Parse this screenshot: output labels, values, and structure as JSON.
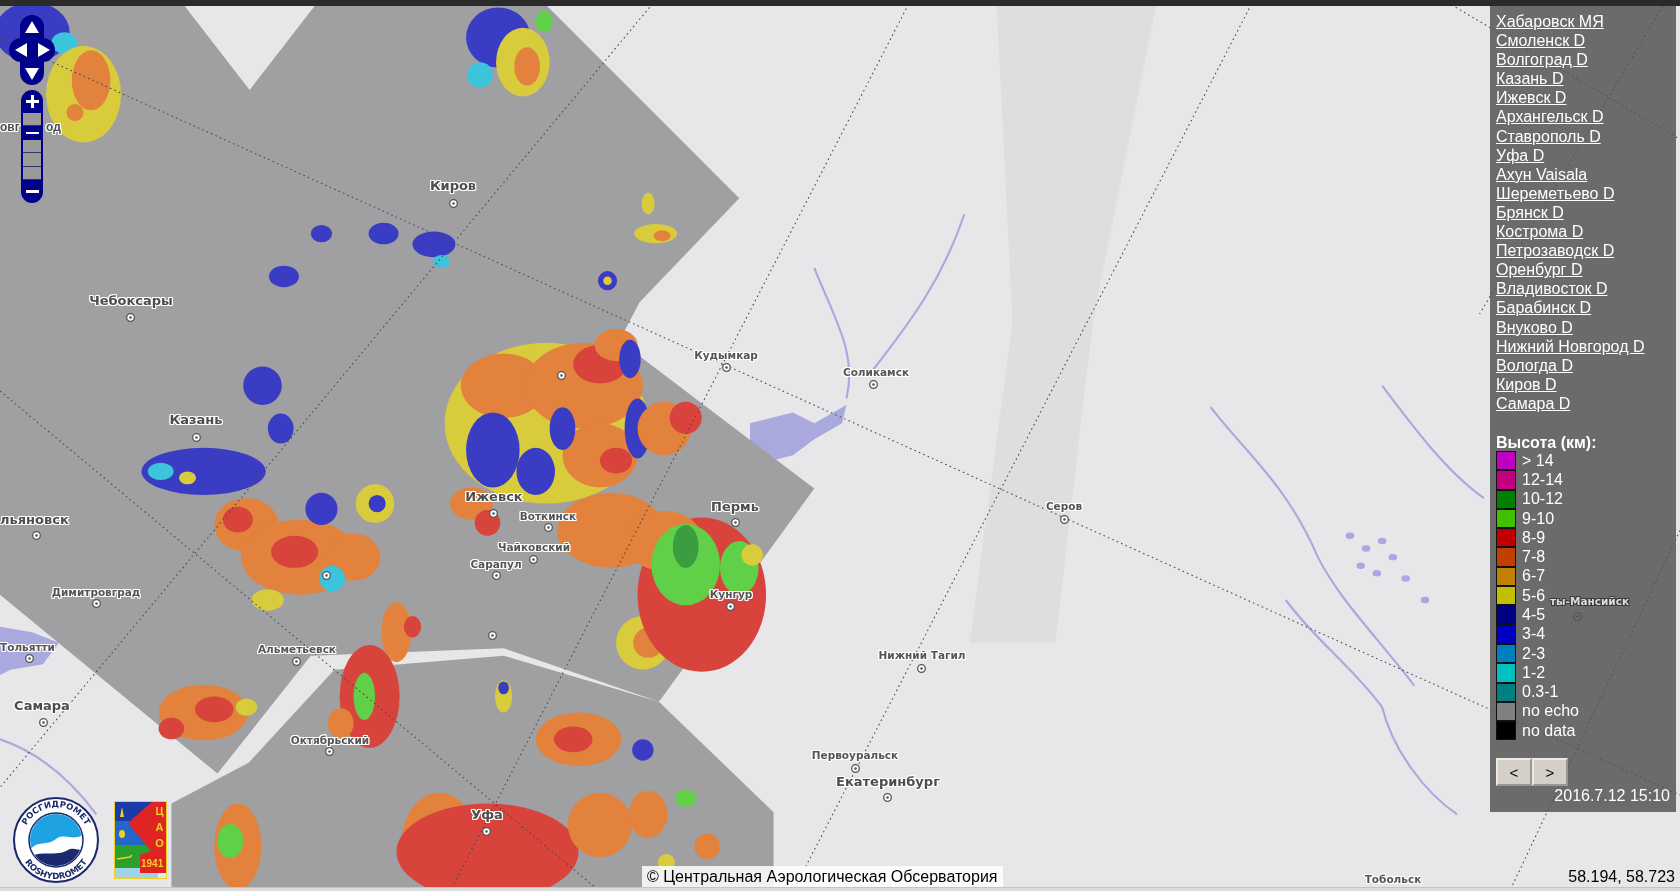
{
  "map_controls": {
    "zoom": {
      "steps": [
        {
          "selected": false
        },
        {
          "selected": true
        },
        {
          "selected": false
        },
        {
          "selected": false
        },
        {
          "selected": false
        }
      ]
    }
  },
  "map": {
    "cities": [
      {
        "name_parts": [
          "овг",
          "од"
        ],
        "kind": "major"
      },
      {
        "name": "Киров",
        "kind": "major"
      },
      {
        "name": "Чебоксары",
        "kind": "major"
      },
      {
        "name": "Кудымкар",
        "kind": "minor"
      },
      {
        "name": "Соликамск",
        "kind": "minor"
      },
      {
        "name": "Казань",
        "kind": "major"
      },
      {
        "name": "Ижевск",
        "kind": "major"
      },
      {
        "name": "Воткинск",
        "kind": "minor"
      },
      {
        "name": "Пермь",
        "kind": "major"
      },
      {
        "name": "Серов",
        "kind": "minor"
      },
      {
        "name": "льяновск",
        "kind": "major"
      },
      {
        "name": "Чайковский",
        "kind": "minor"
      },
      {
        "name": "Сарапул",
        "kind": "minor"
      },
      {
        "name": "Димитровград",
        "kind": "minor"
      },
      {
        "name": "Кунгур",
        "kind": "minor"
      },
      {
        "name": "ты-Мансийск",
        "kind": "minor"
      },
      {
        "name": "Тольятти",
        "kind": "minor"
      },
      {
        "name": "Альметьевск",
        "kind": "minor"
      },
      {
        "name": "Нижний Тагил",
        "kind": "minor"
      },
      {
        "name": "Самара",
        "kind": "major"
      },
      {
        "name": "Октябрьский",
        "kind": "minor"
      },
      {
        "name": "Первоуральск",
        "kind": "minor"
      },
      {
        "name": "Екатеринбург",
        "kind": "major"
      },
      {
        "name": "Уфа",
        "kind": "major"
      },
      {
        "name": "Тобольск",
        "kind": "minor"
      }
    ]
  },
  "stations_panel": {
    "links": [
      "Хабаровск МЯ",
      "Смоленск D",
      "Волгоград D",
      "Казань D",
      "Ижевск D",
      "Архангельск D",
      "Ставрополь D",
      "Уфа D",
      "Ахун Vaisala",
      "Шереметьево D",
      "Брянск D",
      "Кострома D",
      "Петрозаводск D",
      "Оренбург D",
      "Владивосток D",
      "Барабинск D",
      "Внуково D",
      "Нижний Новгород D",
      "Вологда D",
      "Киров D",
      "Самара D"
    ]
  },
  "legend": {
    "title": "Высота (км):",
    "items": [
      {
        "label": "> 14",
        "color": "#c000c0"
      },
      {
        "label": "12-14",
        "color": "#c00080"
      },
      {
        "label": "10-12",
        "color": "#008000"
      },
      {
        "label": "9-10",
        "color": "#40c000"
      },
      {
        "label": "8-9",
        "color": "#c00000"
      },
      {
        "label": "7-8",
        "color": "#c04000"
      },
      {
        "label": "6-7",
        "color": "#c08000"
      },
      {
        "label": "5-6",
        "color": "#c0c000"
      },
      {
        "label": "4-5",
        "color": "#000080"
      },
      {
        "label": "3-4",
        "color": "#0000c0"
      },
      {
        "label": "2-3",
        "color": "#0080c0"
      },
      {
        "label": "1-2",
        "color": "#00c0c0"
      },
      {
        "label": "0.3-1",
        "color": "#008080"
      },
      {
        "label": "no echo",
        "color": "#808080"
      },
      {
        "label": "no data",
        "color": "#000000"
      }
    ]
  },
  "navigation": {
    "buttons": [
      "<",
      ">"
    ],
    "timestamp": "2016.7.12 15:10"
  },
  "logos": {
    "round_logo": {
      "top_text": "РОСГИДРОМЕТ",
      "bottom_text": "ROSHYDROMET"
    },
    "flag_logo": {
      "letters": "ЦАО",
      "year": "1941"
    }
  },
  "attribution": "© Центральная Аэрологическая Обсерватория",
  "coordinates": "58.194, 58.723"
}
